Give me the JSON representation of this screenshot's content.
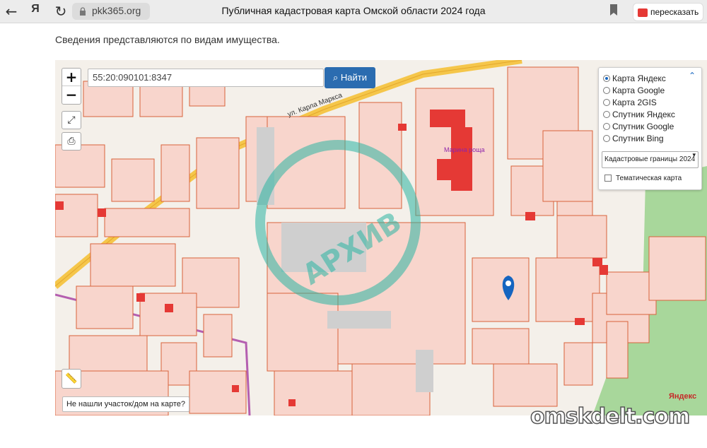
{
  "browser": {
    "url": "pkk365.org",
    "title": "Публичная кадастровая карта Омской области 2024 года",
    "retell_label": "пересказать",
    "back_icon": "arrow-left-icon",
    "reload_icon": "reload-icon"
  },
  "page": {
    "info_text": "Сведения представляются по видам имущества."
  },
  "map": {
    "search_value": "55:20:090101:8347",
    "find_label": "Найти",
    "zoom_in": "+",
    "zoom_out": "−",
    "not_found_label": "Не нашли участок/дом на карте?",
    "attribution": "Яндекс",
    "layers": {
      "options": [
        "Карта Яндекс",
        "Карта Google",
        "Карта 2GIS",
        "Спутник Яндекс",
        "Спутник Google",
        "Спутник Bing"
      ],
      "selected": "Карта Яндекс",
      "cadastral_select": "Кадастровые границы 2024",
      "thematic_label": "Тематическая карта"
    },
    "street_label": "ул. Карла Маркса",
    "poi_label": "Марина роща",
    "stamp_text": "АРХИВ",
    "colors": {
      "parcel_fill": "#f8d5cc",
      "parcel_stroke": "#d9623b",
      "building": "#e53935",
      "road": "#f5c64a",
      "green": "#a8d79b",
      "pin": "#1565c0"
    }
  },
  "watermark": "omskdelt.com"
}
